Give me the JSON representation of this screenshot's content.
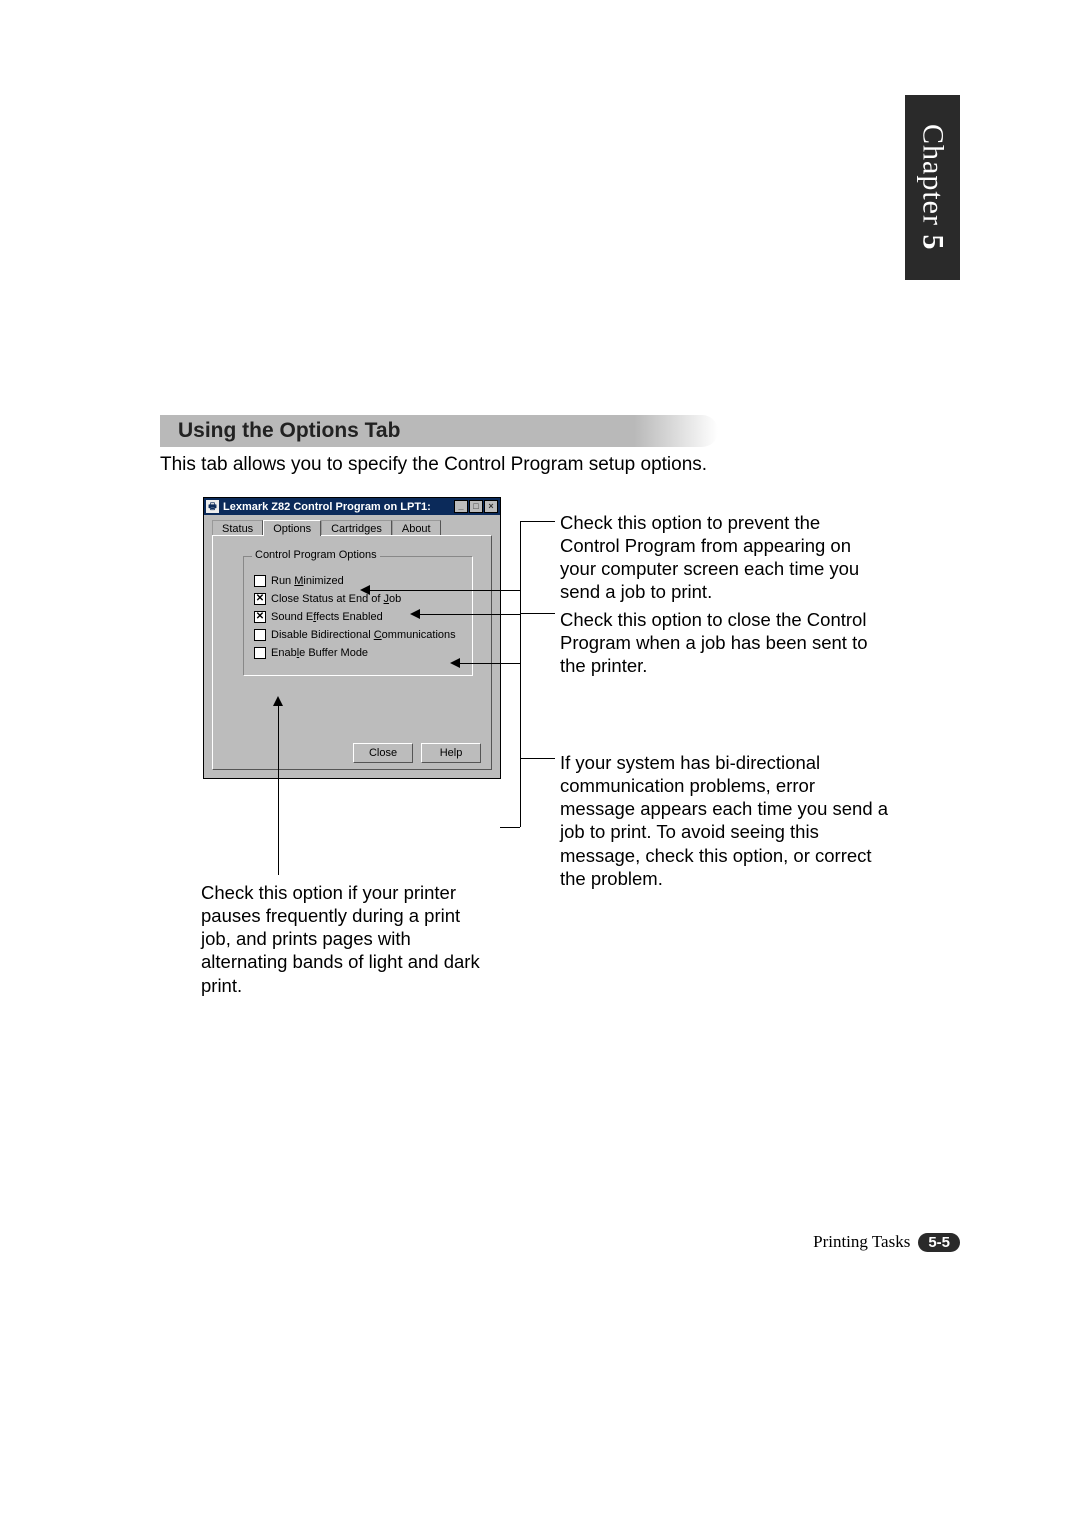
{
  "chapter": {
    "label": "Chapter",
    "number": "5"
  },
  "section_heading": "Using the Options Tab",
  "intro": "This tab allows you to specify the Control Program setup options.",
  "dialog": {
    "title": "Lexmark Z82 Control Program on LPT1:",
    "tabs": {
      "status": "Status",
      "options": "Options",
      "cartridges": "Cartridges",
      "about": "About"
    },
    "group_title": "Control Program Options",
    "options": {
      "run_minimized_pre": "Run ",
      "run_minimized_u": "M",
      "run_minimized_post": "inimized",
      "close_status_pre": "Close Status at End of ",
      "close_status_u": "J",
      "close_status_post": "ob",
      "sound_pre": "Sound E",
      "sound_u": "f",
      "sound_post": "fects Enabled",
      "bidir_pre": "Disable Bidirectional ",
      "bidir_u": "C",
      "bidir_post": "ommunications",
      "buffer_pre": "Enab",
      "buffer_u": "l",
      "buffer_post": "e Buffer Mode"
    },
    "buttons": {
      "close": "Close",
      "help": "Help"
    },
    "win_buttons": {
      "min": "_",
      "max": "□",
      "close": "×"
    }
  },
  "callouts": {
    "c1": "Check this option to prevent the Control Program from appearing on your computer screen each time you send a job to print.",
    "c2": "Check this option to close the Control Program when a job has been sent to the printer.",
    "c3": "If your system has bi-directional communication problems, error message appears each time you send a job to print. To avoid seeing this message, check this option, or correct the problem.",
    "c4": "Check this option if your printer pauses frequently during a print job, and prints pages with alternating bands of light and dark print."
  },
  "footer": {
    "section": "Printing Tasks",
    "page": "5-5"
  }
}
